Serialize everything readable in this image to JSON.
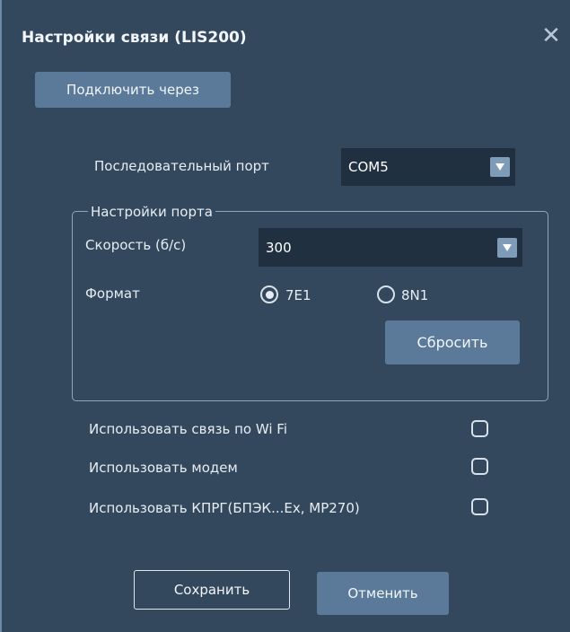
{
  "dialog": {
    "title": "Настройки связи (LIS200)",
    "close_glyph": "✕",
    "connect_via_label": "Подключить через"
  },
  "serial_port": {
    "label": "Последовательный порт",
    "value": "COM5"
  },
  "port_settings": {
    "legend": "Настройки порта",
    "speed_label": "Скорость (б/с)",
    "speed_value": "300",
    "format_label": "Формат",
    "format_options": [
      {
        "label": "7E1",
        "selected": true
      },
      {
        "label": "8N1",
        "selected": false
      }
    ],
    "reset_label": "Сбросить"
  },
  "options": [
    {
      "label": "Использовать связь по Wi Fi",
      "checked": false
    },
    {
      "label": "Использовать модем",
      "checked": false
    },
    {
      "label": "Использовать КПРГ(БПЭК...Ex, MP270)",
      "checked": false
    }
  ],
  "footer": {
    "save_label": "Сохранить",
    "cancel_label": "Отменить"
  },
  "colors": {
    "background": "#34485d",
    "button": "#5b7a9a",
    "select_bg": "#203040",
    "select_arrow": "#7e9bb8"
  },
  "icons": {
    "close": "close-icon",
    "dropdown": "chevron-down-icon"
  }
}
